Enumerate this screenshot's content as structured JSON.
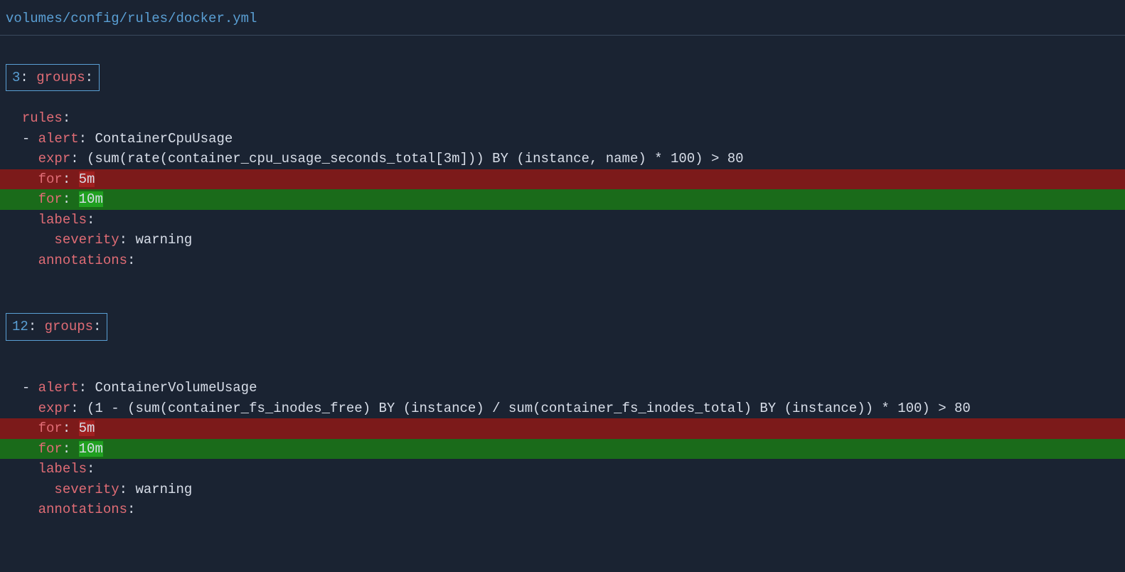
{
  "file_path": "volumes/config/rules/docker.yml",
  "hunks": [
    {
      "header": {
        "line_num": "3",
        "key": "groups",
        "colon": ":"
      },
      "lines": [
        {
          "type": "context",
          "indent": "  ",
          "key": "rules",
          "colon": ":",
          "value": ""
        },
        {
          "type": "context",
          "indent": "  ",
          "dash": "- ",
          "key": "alert",
          "colon": ": ",
          "value": "ContainerCpuUsage"
        },
        {
          "type": "context",
          "indent": "    ",
          "key": "expr",
          "colon": ": ",
          "value": "(sum(rate(container_cpu_usage_seconds_total[3m])) BY (instance, name) * 100) > 80"
        },
        {
          "type": "removed",
          "indent": "    ",
          "key": "for",
          "colon": ": ",
          "value": "5m",
          "highlight_value": true
        },
        {
          "type": "added",
          "indent": "    ",
          "key": "for",
          "colon": ": ",
          "value": "10m",
          "highlight_value": true
        },
        {
          "type": "context",
          "indent": "    ",
          "key": "labels",
          "colon": ":",
          "value": ""
        },
        {
          "type": "context",
          "indent": "      ",
          "key": "severity",
          "colon": ": ",
          "value": "warning"
        },
        {
          "type": "context",
          "indent": "    ",
          "key": "annotations",
          "colon": ":",
          "value": ""
        }
      ]
    },
    {
      "header": {
        "line_num": "12",
        "key": "groups",
        "colon": ":"
      },
      "lines": [
        {
          "type": "blank"
        },
        {
          "type": "context",
          "indent": "  ",
          "dash": "- ",
          "key": "alert",
          "colon": ": ",
          "value": "ContainerVolumeUsage"
        },
        {
          "type": "context",
          "indent": "    ",
          "key": "expr",
          "colon": ": ",
          "value": "(1 - (sum(container_fs_inodes_free) BY (instance) / sum(container_fs_inodes_total) BY (instance)) * 100) > 80"
        },
        {
          "type": "removed",
          "indent": "    ",
          "key": "for",
          "colon": ": ",
          "value": "5m",
          "highlight_value": true
        },
        {
          "type": "added",
          "indent": "    ",
          "key": "for",
          "colon": ": ",
          "value": "10m",
          "highlight_value": true
        },
        {
          "type": "context",
          "indent": "    ",
          "key": "labels",
          "colon": ":",
          "value": ""
        },
        {
          "type": "context",
          "indent": "      ",
          "key": "severity",
          "colon": ": ",
          "value": "warning"
        },
        {
          "type": "context",
          "indent": "    ",
          "key": "annotations",
          "colon": ":",
          "value": ""
        }
      ]
    }
  ]
}
